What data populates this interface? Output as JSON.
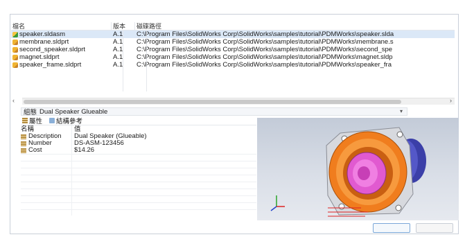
{
  "table": {
    "headers": {
      "name": "檔名",
      "version": "版本",
      "path": "磁碟路徑"
    },
    "rows": [
      {
        "icon": "assembly-icon",
        "name": "speaker.sldasm",
        "version": "A.1",
        "path": "C:\\Program Files\\SolidWorks Corp\\SolidWorks\\samples\\tutorial\\PDMWorks\\speaker.slda"
      },
      {
        "icon": "part-icon",
        "name": "membrane.sldprt",
        "version": "A.1",
        "path": "C:\\Program Files\\SolidWorks Corp\\SolidWorks\\samples\\tutorial\\PDMWorks\\membrane.s"
      },
      {
        "icon": "part-icon",
        "name": "second_speaker.sldprt",
        "version": "A.1",
        "path": "C:\\Program Files\\SolidWorks Corp\\SolidWorks\\samples\\tutorial\\PDMWorks\\second_spe"
      },
      {
        "icon": "part-icon",
        "name": "magnet.sldprt",
        "version": "A.1",
        "path": "C:\\Program Files\\SolidWorks Corp\\SolidWorks\\samples\\tutorial\\PDMWorks\\magnet.sldp"
      },
      {
        "icon": "part-icon",
        "name": "speaker_frame.sldprt",
        "version": "A.1",
        "path": "C:\\Program Files\\SolidWorks Corp\\SolidWorks\\samples\\tutorial\\PDMWorks\\speaker_fra"
      }
    ]
  },
  "config": {
    "label": "組態",
    "value": "Dual Speaker Glueable"
  },
  "tabs": {
    "properties": "屬性",
    "references": "結構參考"
  },
  "props": {
    "headers": {
      "name": "名稱",
      "value": "值"
    },
    "rows": [
      {
        "name": "Description",
        "value": "Dual Speaker (Glueable)"
      },
      {
        "name": "Number",
        "value": "DS-ASM-123456"
      },
      {
        "name": "Cost",
        "value": "$14.26"
      }
    ]
  },
  "colors": {
    "selected_row": "#dbe8f7",
    "frame_orange": "#f07d1e",
    "cone_pink": "#e15ad0"
  }
}
